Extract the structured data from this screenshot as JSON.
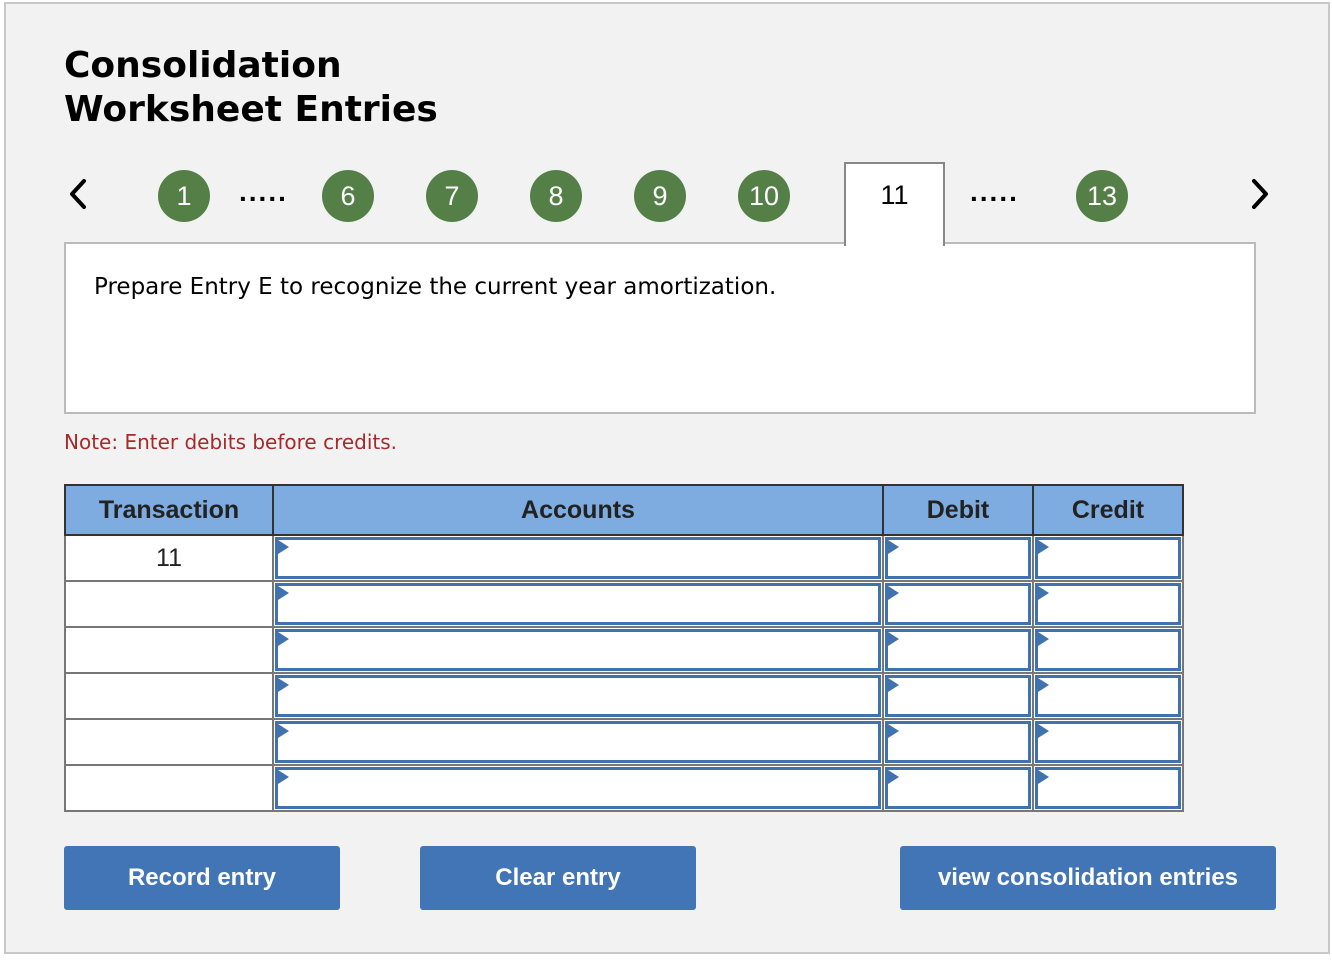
{
  "header": {
    "title_line1": "Consolidation",
    "title_line2": "Worksheet Entries"
  },
  "stepper": {
    "prev_icon": "chevron-left-icon",
    "next_icon": "chevron-right-icon",
    "steps": [
      "1",
      "6",
      "7",
      "8",
      "9",
      "10",
      "11",
      "13"
    ],
    "ellipsis": ".....",
    "active_step": "11",
    "step_color": "#548048"
  },
  "prompt": {
    "text": "Prepare Entry E to recognize the current year amortization."
  },
  "note": {
    "text": "Note: Enter debits before credits.",
    "color": "#a52a2a"
  },
  "table": {
    "headers": {
      "transaction": "Transaction",
      "accounts": "Accounts",
      "debit": "Debit",
      "credit": "Credit"
    },
    "rows": [
      {
        "transaction": "11",
        "account": "",
        "debit": "",
        "credit": ""
      },
      {
        "transaction": "",
        "account": "",
        "debit": "",
        "credit": ""
      },
      {
        "transaction": "",
        "account": "",
        "debit": "",
        "credit": ""
      },
      {
        "transaction": "",
        "account": "",
        "debit": "",
        "credit": ""
      },
      {
        "transaction": "",
        "account": "",
        "debit": "",
        "credit": ""
      },
      {
        "transaction": "",
        "account": "",
        "debit": "",
        "credit": ""
      }
    ]
  },
  "buttons": {
    "record": "Record entry",
    "clear": "Clear entry",
    "view": "view consolidation entries",
    "color": "#4275b5"
  }
}
